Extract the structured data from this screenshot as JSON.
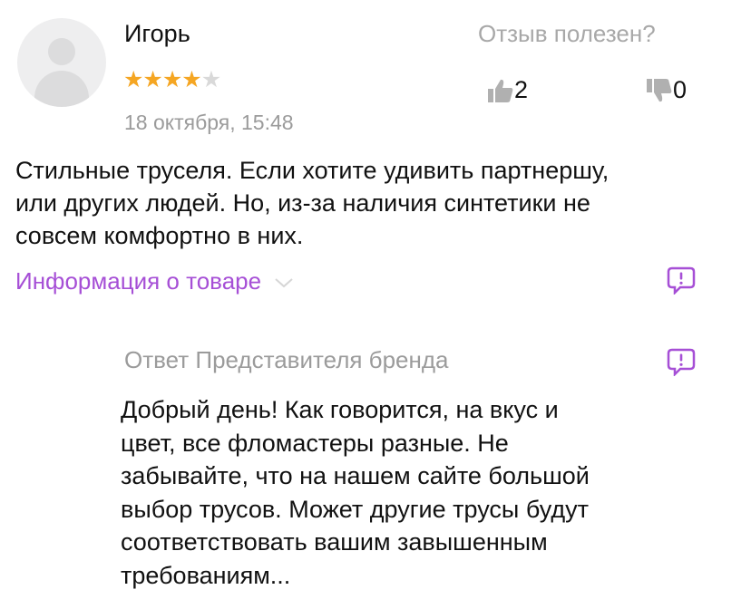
{
  "review": {
    "author": "Игорь",
    "rating": 4,
    "rating_max": 5,
    "date": "18 октября, 15:48",
    "helpful_label": "Отзыв полезен?",
    "likes": "2",
    "dislikes": "0",
    "text_lines": [
      "Стильные труселя. Если хотите  удивить партнершу,",
      "или других людей. Но, из-за наличия синтетики не",
      "совсем комфортно в них."
    ],
    "info_link": "Информация о товаре"
  },
  "brand_reply": {
    "title": "Ответ Представителя бренда",
    "text_lines": [
      "Добрый день! Как говорится, на вкус и",
      "цвет, все фломастеры разные. Не",
      "забывайте, что на нашем сайте большой",
      "выбор трусов. Может другие трусы будут",
      "соответствовать вашим завышенным",
      "требованиям..."
    ]
  },
  "colors": {
    "accent": "#a64fd6",
    "star_on": "#f5a623",
    "star_off": "#d9d9d9",
    "muted": "#9b9b9b"
  },
  "icons": {
    "avatar": "user-avatar-placeholder",
    "like": "thumbs-up-icon",
    "dislike": "thumbs-down-icon",
    "report": "report-message-icon",
    "chevron": "chevron-down-icon"
  }
}
